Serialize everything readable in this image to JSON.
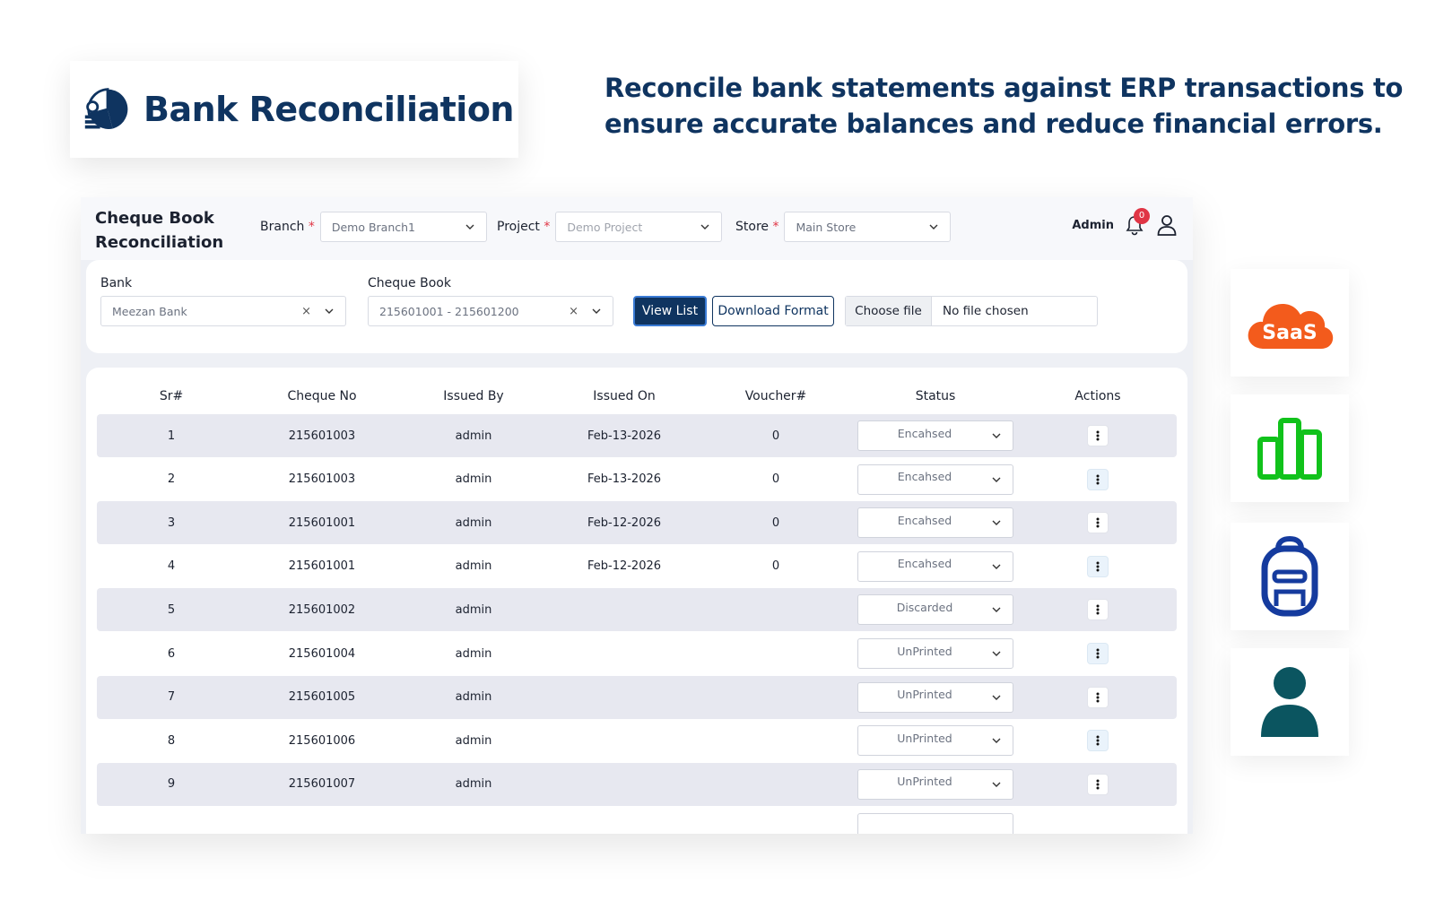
{
  "hero": {
    "title": "Bank Reconciliation",
    "tagline": "Reconcile bank statements against ERP transactions to ensure accurate balances and reduce financial errors."
  },
  "app": {
    "title_line1": "Cheque Book",
    "title_line2": "Reconciliation",
    "branch": {
      "label": "Branch",
      "value": "Demo Branch1"
    },
    "project": {
      "label": "Project",
      "value": "Demo Project"
    },
    "store": {
      "label": "Store",
      "value": "Main Store"
    },
    "required_mark": "*",
    "user_name": "Admin",
    "notification_count": "0"
  },
  "filters": {
    "bank": {
      "label": "Bank",
      "value": "Meezan Bank"
    },
    "cheque_book": {
      "label": "Cheque Book",
      "value": "215601001 - 215601200"
    },
    "clear_glyph": "×",
    "view_list_label": "View List",
    "download_format_label": "Download Format",
    "file": {
      "choose_label": "Choose file",
      "status": "No file chosen"
    }
  },
  "table": {
    "columns": [
      "Sr#",
      "Cheque No",
      "Issued By",
      "Issued On",
      "Voucher#",
      "Status",
      "Actions"
    ],
    "rows": [
      {
        "sr": "1",
        "cheque_no": "215601003",
        "issued_by": "admin",
        "issued_on": "Feb-13-2026",
        "voucher": "0",
        "status": "Encahsed"
      },
      {
        "sr": "2",
        "cheque_no": "215601003",
        "issued_by": "admin",
        "issued_on": "Feb-13-2026",
        "voucher": "0",
        "status": "Encahsed"
      },
      {
        "sr": "3",
        "cheque_no": "215601001",
        "issued_by": "admin",
        "issued_on": "Feb-12-2026",
        "voucher": "0",
        "status": "Encahsed"
      },
      {
        "sr": "4",
        "cheque_no": "215601001",
        "issued_by": "admin",
        "issued_on": "Feb-12-2026",
        "voucher": "0",
        "status": "Encahsed"
      },
      {
        "sr": "5",
        "cheque_no": "215601002",
        "issued_by": "admin",
        "issued_on": "",
        "voucher": "",
        "status": "Discarded"
      },
      {
        "sr": "6",
        "cheque_no": "215601004",
        "issued_by": "admin",
        "issued_on": "",
        "voucher": "",
        "status": "UnPrinted"
      },
      {
        "sr": "7",
        "cheque_no": "215601005",
        "issued_by": "admin",
        "issued_on": "",
        "voucher": "",
        "status": "UnPrinted"
      },
      {
        "sr": "8",
        "cheque_no": "215601006",
        "issued_by": "admin",
        "issued_on": "",
        "voucher": "",
        "status": "UnPrinted"
      },
      {
        "sr": "9",
        "cheque_no": "215601007",
        "issued_by": "admin",
        "issued_on": "",
        "voucher": "",
        "status": "UnPrinted"
      }
    ]
  },
  "features": {
    "saas_label": "SaaS",
    "icons": [
      "saas-cloud-icon",
      "bar-chart-icon",
      "backpack-icon",
      "user-icon"
    ],
    "colors": {
      "saas": "#f35b1c",
      "chart": "#11c21b",
      "backpack": "#153b9e",
      "user": "#0b5560",
      "brand": "#0f3460"
    }
  }
}
